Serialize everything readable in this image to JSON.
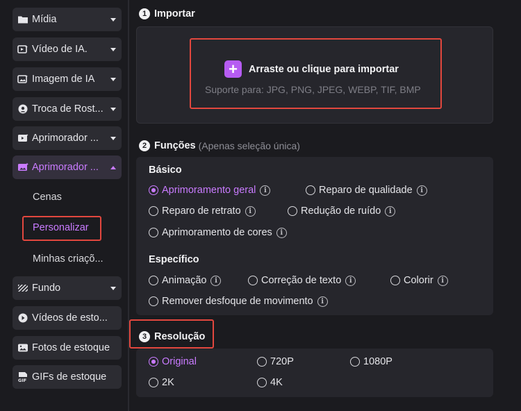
{
  "sidebar": {
    "items": [
      {
        "label": "Mídia",
        "icon": "folder-icon",
        "caret": "down"
      },
      {
        "label": "Vídeo de IA.",
        "icon": "ai-video-icon",
        "caret": "down"
      },
      {
        "label": "Imagem de IA",
        "icon": "ai-image-icon",
        "caret": "down"
      },
      {
        "label": "Troca de Rost...",
        "icon": "face-swap-icon",
        "caret": "down"
      },
      {
        "label": "Aprimorador ...",
        "icon": "video-enhancer-icon",
        "caret": "down"
      },
      {
        "label": "Aprimorador ...",
        "icon": "image-enhancer-icon",
        "caret": "up",
        "active": true
      },
      {
        "label": "Fundo",
        "icon": "background-icon",
        "caret": "down"
      },
      {
        "label": "Vídeos de esto...",
        "icon": "play-icon"
      },
      {
        "label": "Fotos de estoque",
        "icon": "photo-icon"
      },
      {
        "label": "GIFs de estoque",
        "icon": "gif-icon"
      }
    ],
    "sub_items": [
      {
        "label": "Cenas"
      },
      {
        "label": "Personalizar",
        "active": true
      },
      {
        "label": "Minhas criaçõ..."
      }
    ]
  },
  "import": {
    "number": "1",
    "title": "Importar",
    "button_label": "Arraste ou clique para importar",
    "support_text": "Suporte para: JPG, PNG, JPEG, WEBP, TIF, BMP"
  },
  "functions": {
    "number": "2",
    "title": "Funções",
    "note": "(Apenas seleção única)",
    "basic_title": "Básico",
    "basic_options": [
      {
        "label": "Aprimoramento geral",
        "selected": true
      },
      {
        "label": "Reparo de qualidade"
      },
      {
        "label": "Reparo de retrato"
      },
      {
        "label": "Redução de ruído"
      },
      {
        "label": "Aprimoramento de cores"
      }
    ],
    "specific_title": "Específico",
    "specific_options": [
      {
        "label": "Animação"
      },
      {
        "label": "Correção de texto"
      },
      {
        "label": "Colorir"
      },
      {
        "label": "Remover desfoque de movimento"
      }
    ]
  },
  "resolution": {
    "number": "3",
    "title": "Resolução",
    "options": [
      {
        "label": "Original",
        "selected": true
      },
      {
        "label": "720P"
      },
      {
        "label": "1080P"
      },
      {
        "label": "2K"
      },
      {
        "label": "4K"
      }
    ]
  },
  "colors": {
    "accent": "#c97bff",
    "highlight_border": "#e2473e",
    "panel": "#26262c",
    "background": "#1b1b1f"
  }
}
